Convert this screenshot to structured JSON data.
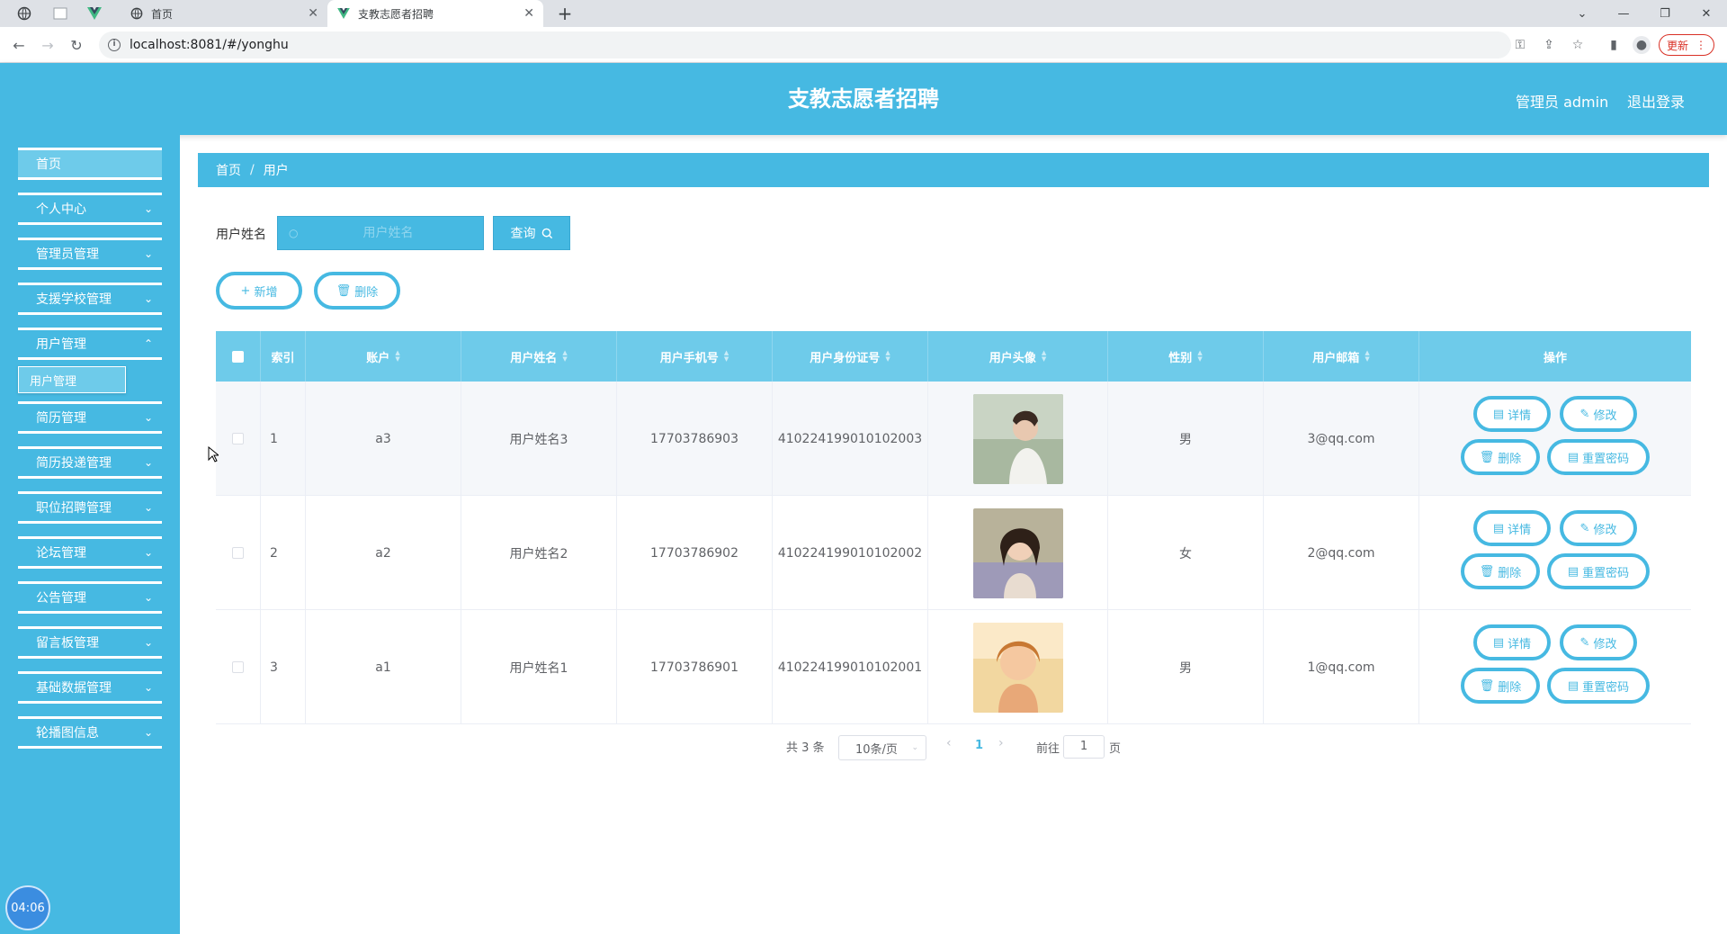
{
  "browser": {
    "tabs": [
      {
        "title": "首页"
      },
      {
        "title": "支教志愿者招聘"
      }
    ],
    "url": "localhost:8081/#/yonghu",
    "update_label": "更新"
  },
  "header": {
    "title": "支教志愿者招聘",
    "user": "管理员 admin",
    "logout": "退出登录"
  },
  "sidebar": {
    "items": [
      {
        "label": "首页"
      },
      {
        "label": "个人中心"
      },
      {
        "label": "管理员管理"
      },
      {
        "label": "支援学校管理"
      },
      {
        "label": "用户管理"
      },
      {
        "label": "简历管理"
      },
      {
        "label": "简历投递管理"
      },
      {
        "label": "职位招聘管理"
      },
      {
        "label": "论坛管理"
      },
      {
        "label": "公告管理"
      },
      {
        "label": "留言板管理"
      },
      {
        "label": "基础数据管理"
      },
      {
        "label": "轮播图信息"
      }
    ],
    "subitem": "用户管理"
  },
  "breadcrumb": {
    "home": "首页",
    "current": "用户"
  },
  "search": {
    "label": "用户姓名",
    "placeholder": "用户姓名",
    "button": "查询"
  },
  "actions": {
    "add": "新增",
    "delete": "删除"
  },
  "table": {
    "columns": [
      "索引",
      "账户",
      "用户姓名",
      "用户手机号",
      "用户身份证号",
      "用户头像",
      "性别",
      "用户邮箱",
      "操作"
    ],
    "rows": [
      {
        "index": "1",
        "account": "a3",
        "name": "用户姓名3",
        "phone": "17703786903",
        "id_card": "410224199010102003",
        "gender": "男",
        "email": "3@qq.com"
      },
      {
        "index": "2",
        "account": "a2",
        "name": "用户姓名2",
        "phone": "17703786902",
        "id_card": "410224199010102002",
        "gender": "女",
        "email": "2@qq.com"
      },
      {
        "index": "3",
        "account": "a1",
        "name": "用户姓名1",
        "phone": "17703786901",
        "id_card": "410224199010102001",
        "gender": "男",
        "email": "1@qq.com"
      }
    ],
    "row_actions": {
      "detail": "详情",
      "edit": "修改",
      "delete": "删除",
      "reset": "重置密码"
    }
  },
  "pagination": {
    "total": "共 3 条",
    "page_size": "10条/页",
    "current": "1",
    "goto": "前往",
    "goto_value": "1",
    "unit": "页"
  },
  "timer": "04:06",
  "colors": {
    "primary": "#46b9e2",
    "primary_light": "#6ecbea"
  }
}
